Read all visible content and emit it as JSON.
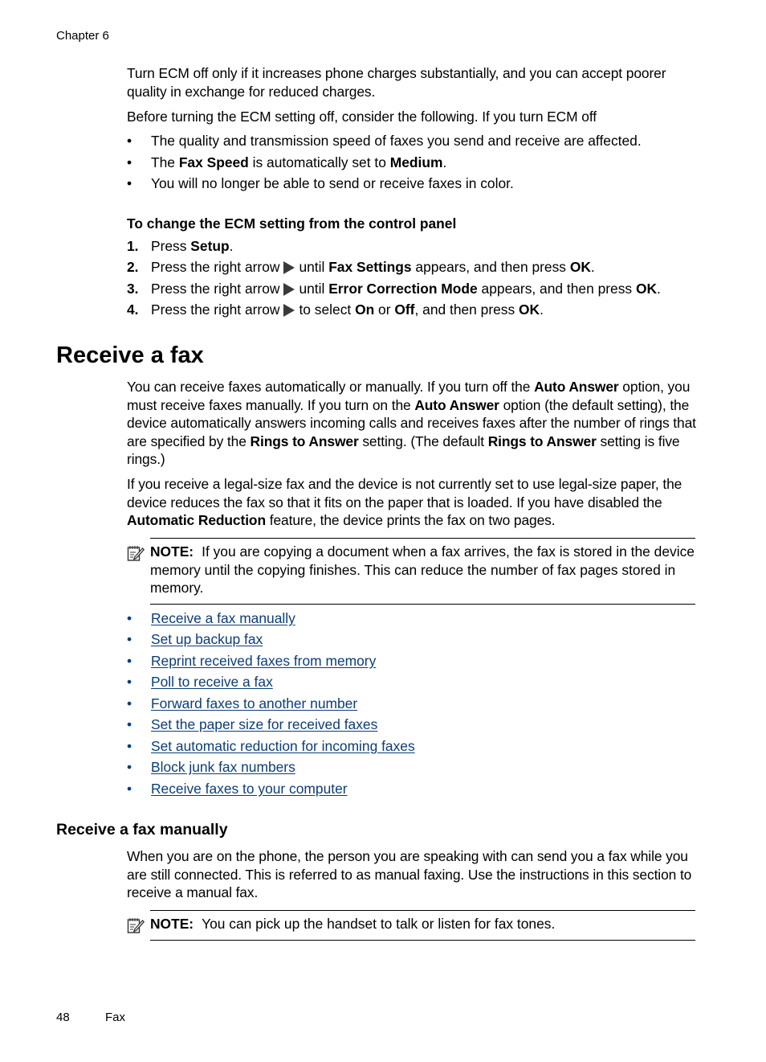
{
  "header": {
    "chapter": "Chapter 6"
  },
  "ecm": {
    "para1": "Turn ECM off only if it increases phone charges substantially, and you can accept poorer quality in exchange for reduced charges.",
    "para2": "Before turning the ECM setting off, consider the following. If you turn ECM off",
    "bullets": [
      {
        "text": "The quality and transmission speed of faxes you send and receive are affected."
      },
      {
        "pre": "The ",
        "b1": "Fax Speed",
        "mid": " is automatically set to ",
        "b2": "Medium",
        "post": "."
      },
      {
        "text": "You will no longer be able to send or receive faxes in color."
      }
    ],
    "bullet_char": "•",
    "procedure_title": "To change the ECM setting from the control panel",
    "steps": [
      {
        "num": "1.",
        "pre": "Press ",
        "b1": "Setup",
        "post": "."
      },
      {
        "num": "2.",
        "pre": "Press the right arrow",
        "mid": "until ",
        "b1": "Fax Settings",
        "mid2": " appears, and then press ",
        "b2": "OK",
        "post": "."
      },
      {
        "num": "3.",
        "pre": "Press the right arrow",
        "mid": "until ",
        "b1": "Error Correction Mode",
        "mid2": " appears, and then press ",
        "b2": "OK",
        "post": "."
      },
      {
        "num": "4.",
        "pre": "Press the right arrow",
        "mid": "to select ",
        "b1": "On",
        "mid2": " or ",
        "b2": "Off",
        "mid3": ", and then press ",
        "b3": "OK",
        "post": "."
      }
    ],
    "arrow_icon": "right-arrow-icon"
  },
  "receive": {
    "title": "Receive a fax",
    "para1": {
      "t1": "You can receive faxes automatically or manually. If you turn off the ",
      "b1": "Auto Answer",
      "t2": " option, you must receive faxes manually. If you turn on the ",
      "b2": "Auto Answer",
      "t3": " option (the default setting), the device automatically answers incoming calls and receives faxes after the number of rings that are specified by the ",
      "b3": "Rings to Answer",
      "t4": " setting. (The default ",
      "b4": "Rings to Answer",
      "t5": " setting is five rings.)"
    },
    "para2": {
      "t1": "If you receive a legal-size fax and the device is not currently set to use legal-size paper, the device reduces the fax so that it fits on the paper that is loaded. If you have disabled the ",
      "b1": "Automatic Reduction",
      "t2": " feature, the device prints the fax on two pages."
    },
    "note": {
      "label": "NOTE:",
      "text": "If you are copying a document when a fax arrives, the fax is stored in the device memory until the copying finishes. This can reduce the number of fax pages stored in memory."
    },
    "links": [
      "Receive a fax manually",
      "Set up backup fax",
      "Reprint received faxes from memory",
      "Poll to receive a fax",
      "Forward faxes to another number",
      "Set the paper size for received faxes",
      "Set automatic reduction for incoming faxes",
      "Block junk fax numbers",
      "Receive faxes to your computer"
    ],
    "link_color": "#0b3d78"
  },
  "manual": {
    "title": "Receive a fax manually",
    "para": "When you are on the phone, the person you are speaking with can send you a fax while you are still connected. This is referred to as manual faxing. Use the instructions in this section to receive a manual fax.",
    "note": {
      "label": "NOTE:",
      "text": "You can pick up the handset to talk or listen for fax tones."
    }
  },
  "footer": {
    "page_number": "48",
    "section": "Fax"
  }
}
